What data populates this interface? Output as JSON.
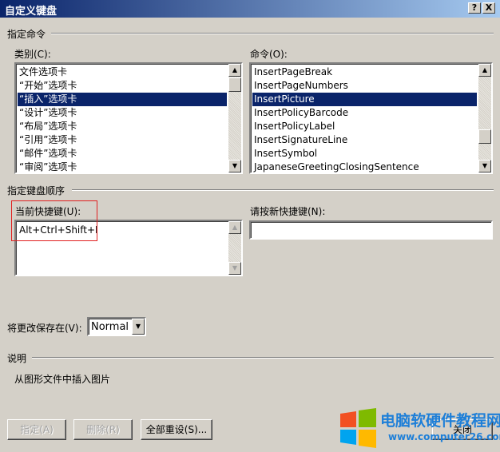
{
  "window": {
    "title": "自定义键盘",
    "help_btn": "?",
    "close_btn": "X"
  },
  "specify_command": {
    "heading": "指定命令",
    "categories_label": "类别(C):",
    "categories": [
      {
        "label": "文件选项卡"
      },
      {
        "label": "“开始”选项卡"
      },
      {
        "label": "“插入”选项卡",
        "selected": true
      },
      {
        "label": "“设计”选项卡"
      },
      {
        "label": "“布局”选项卡"
      },
      {
        "label": "“引用”选项卡"
      },
      {
        "label": "“邮件”选项卡"
      },
      {
        "label": "“审阅”选项卡"
      }
    ],
    "commands_label": "命令(O):",
    "commands": [
      {
        "label": "InsertPageBreak"
      },
      {
        "label": "InsertPageNumbers"
      },
      {
        "label": "InsertPicture",
        "selected": true
      },
      {
        "label": "InsertPolicyBarcode"
      },
      {
        "label": "InsertPolicyLabel"
      },
      {
        "label": "InsertSignatureLine"
      },
      {
        "label": "InsertSymbol"
      },
      {
        "label": "JapaneseGreetingClosingSentence"
      }
    ]
  },
  "shortcut": {
    "heading": "指定键盘顺序",
    "current_label": "当前快捷键(U):",
    "current_keys": [
      "Alt+Ctrl+Shift+I"
    ],
    "new_label": "请按新快捷键(N):",
    "new_value": ""
  },
  "save_in": {
    "label": "将更改保存在(V):",
    "value": "Normal"
  },
  "description": {
    "heading": "说明",
    "text": "从图形文件中插入图片"
  },
  "buttons": {
    "assign": "指定(A)",
    "remove": "删除(R)",
    "reset_all": "全部重设(S)...",
    "close": "关闭"
  },
  "watermark": {
    "title": "电脑软硬件教程网",
    "url": "www.computer26.com"
  },
  "colors": {
    "title_bar": "#0a246a",
    "selection": "#0a246a",
    "highlight_box": "#e02020",
    "watermark": "#1e7fd8"
  }
}
